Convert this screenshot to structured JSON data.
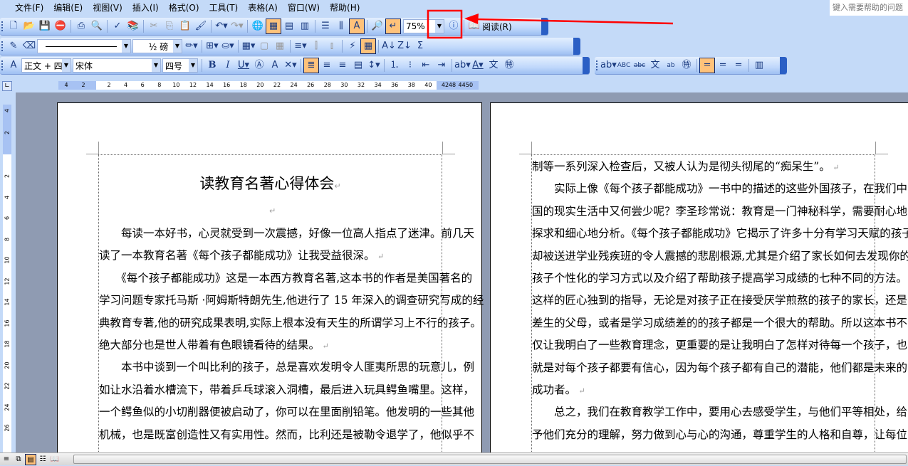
{
  "menu": [
    "文件(F)",
    "编辑(E)",
    "视图(V)",
    "插入(I)",
    "格式(O)",
    "工具(T)",
    "表格(A)",
    "窗口(W)",
    "帮助(H)"
  ],
  "help_placeholder": "键入需要帮助的问题",
  "standard_toolbar": {
    "zoom": "75%",
    "read_label": "阅读(R)"
  },
  "tables_toolbar": {
    "line_weight": "½ 磅"
  },
  "formatting_toolbar": {
    "style": "正文 + 四号",
    "font": "宋体",
    "size": "四号"
  },
  "ruler": {
    "h_left": [
      "4",
      "2"
    ],
    "h_main": [
      "2",
      "4",
      "6",
      "8",
      "10",
      "12",
      "14",
      "16",
      "18",
      "20",
      "22",
      "24",
      "26",
      "28",
      "30",
      "32",
      "34",
      "36",
      "38",
      "40",
      "42",
      "44"
    ],
    "h_right": [
      "48",
      "50"
    ],
    "v_top": [
      "4",
      "2"
    ],
    "v_main": [
      "2",
      "4",
      "6",
      "8",
      "10",
      "12",
      "14",
      "16",
      "18",
      "20",
      "22",
      "24",
      "26"
    ]
  },
  "accent": "#ffc27a",
  "annotation_color": "#ff0000",
  "page1": {
    "title": "读教育名著心得体会",
    "lines": [
      {
        "t": "　　每读一本好书，心灵就受到一次震撼，好像一位高人指点了迷津。前几天"
      },
      {
        "t": "读了一本教育名著《每个孩子都能成功》让我受益很深。",
        "last": true
      },
      {
        "t": "　　《每个孩子都能成功》这是一本西方教育名著,这本书的作者是美国著名的"
      },
      {
        "t": "学习问题专家托马斯 ·阿姆斯特朗先生,他进行了 15 年深入的调查研究写成的经"
      },
      {
        "t": "典教育专著,他的研究成果表明,实际上根本没有天生的所谓学习上不行的孩子。"
      },
      {
        "t": "绝大部分也是世人带着有色眼镜看待的结果。",
        "last": true
      },
      {
        "t": "　　本书中谈到一个叫比利的孩子，总是喜欢发明令人匪夷所思的玩意儿，例"
      },
      {
        "t": "如让水沿着水槽流下，带着乒乓球滚入洞槽，最后进入玩具鳄鱼嘴里。这样，"
      },
      {
        "t": "一个鳄鱼似的小切削器便被启动了，你可以在里面削铅笔。他发明的一些其他"
      },
      {
        "t": "机械，也是既富创造性又有实用性。然而，比利还是被勒令退学了，他似乎不"
      }
    ]
  },
  "page2": {
    "lines": [
      {
        "t": "制等一系列深入检查后，又被人认为是彻头彻尾的“痴呆生”。",
        "last": true
      },
      {
        "t": "　　实际上像《每个孩子都能成功》一书中的描述的这些外国孩子，在我们中"
      },
      {
        "t": "国的现实生活中又何尝少呢？李圣珍常说：教育是一门神秘科学，需要耐心地"
      },
      {
        "t": "探求和细心地分析。《每个孩子都能成功》它揭示了许多十分有学习天赋的孩子"
      },
      {
        "t": "却被送进学业残疾班的令人震撼的悲剧根源,尤其是介绍了家长如何去发现你的"
      },
      {
        "t": "孩子个性化的学习方式以及介绍了帮助孩子提高学习成绩的七种不同的方法。"
      },
      {
        "t": "这样的匠心独到的指导，无论是对孩子正在接受厌学煎熬的孩子的家长，还是"
      },
      {
        "t": "差生的父母，或者是学习成绩差的的孩子都是一个很大的帮助。所以这本书不"
      },
      {
        "t": "仅让我明白了一些教育理念，更重要的是让我明白了怎样对待每一个孩子，也"
      },
      {
        "t": "就是对每个孩子都要有信心，因为每个孩子都有自己的潜能，他们都是未来的"
      },
      {
        "t": "成功者。",
        "last": true
      },
      {
        "t": "　　总之，我们在教育教学工作中，要用心去感受学生，与他们平等相处，给"
      },
      {
        "t": "予他们充分的理解，努力做到心与心的沟通，尊重学生的人格和自尊，让每位"
      }
    ]
  }
}
